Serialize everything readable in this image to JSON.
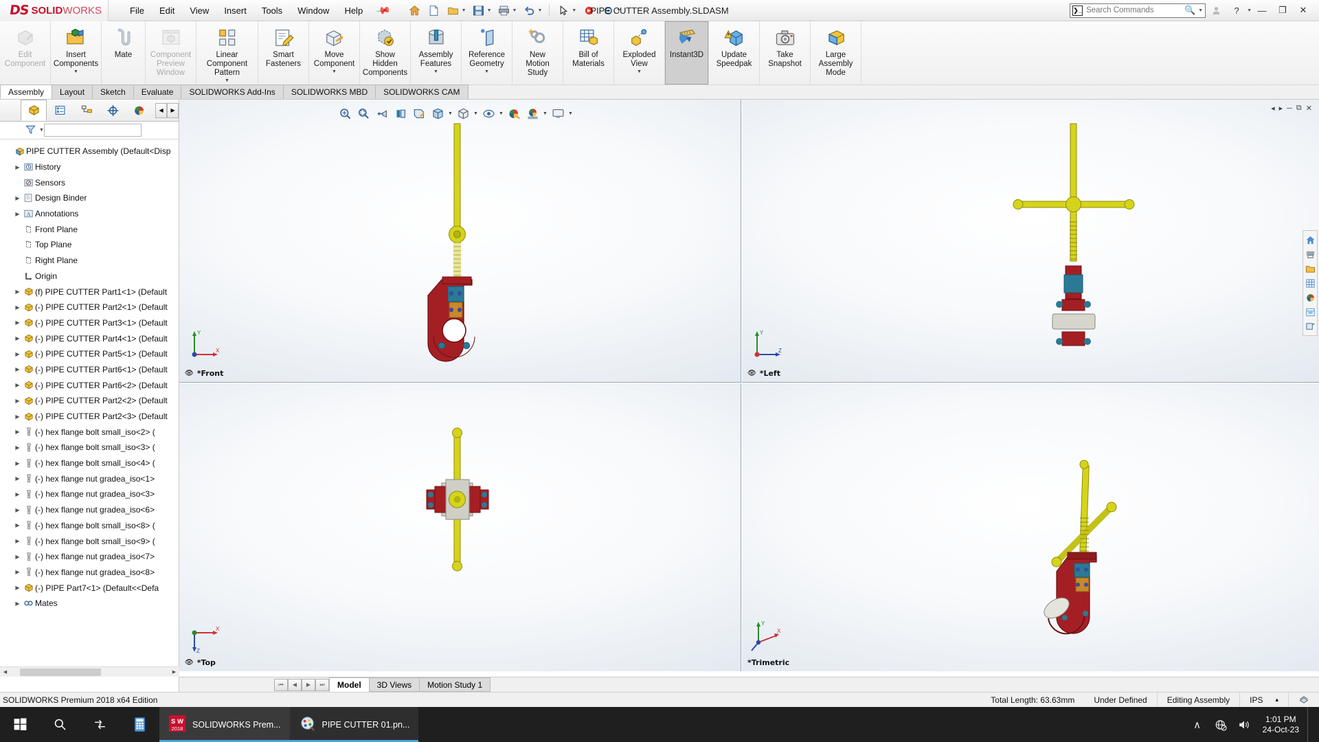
{
  "app": {
    "brand_ds": "DS",
    "brand_solid": "SOLID",
    "brand_works": "WORKS",
    "document_title": "PIPE CUTTER Assembly.SLDASM",
    "edition": "SOLIDWORKS Premium 2018 x64 Edition"
  },
  "menubar": [
    "File",
    "Edit",
    "View",
    "Insert",
    "Tools",
    "Window",
    "Help"
  ],
  "search": {
    "placeholder": "Search Commands",
    "value": ""
  },
  "window_controls": {
    "minimize": "—",
    "restore": "❐",
    "close": "✕",
    "help": "?"
  },
  "ribbon": {
    "buttons": [
      {
        "label": "Edit\nComponent",
        "icon": "edit-component-icon",
        "disabled": true,
        "active": false,
        "caret": false
      },
      {
        "label": "Insert\nComponents",
        "icon": "insert-components-icon",
        "disabled": false,
        "active": false,
        "caret": true
      },
      {
        "label": "Mate",
        "icon": "mate-icon",
        "disabled": false,
        "active": false,
        "caret": false
      },
      {
        "label": "Component\nPreview\nWindow",
        "icon": "component-preview-icon",
        "disabled": true,
        "active": false,
        "caret": false
      },
      {
        "label": "Linear Component\nPattern",
        "icon": "linear-pattern-icon",
        "disabled": false,
        "active": false,
        "caret": true
      },
      {
        "label": "Smart\nFasteners",
        "icon": "smart-fasteners-icon",
        "disabled": false,
        "active": false,
        "caret": false
      },
      {
        "label": "Move\nComponent",
        "icon": "move-component-icon",
        "disabled": false,
        "active": false,
        "caret": true
      },
      {
        "label": "Show\nHidden\nComponents",
        "icon": "show-hidden-icon",
        "disabled": false,
        "active": false,
        "caret": false
      },
      {
        "label": "Assembly\nFeatures",
        "icon": "assembly-features-icon",
        "disabled": false,
        "active": false,
        "caret": true
      },
      {
        "label": "Reference\nGeometry",
        "icon": "reference-geometry-icon",
        "disabled": false,
        "active": false,
        "caret": true
      },
      {
        "label": "New\nMotion\nStudy",
        "icon": "new-motion-study-icon",
        "disabled": false,
        "active": false,
        "caret": false
      },
      {
        "label": "Bill of\nMaterials",
        "icon": "bill-of-materials-icon",
        "disabled": false,
        "active": false,
        "caret": false
      },
      {
        "label": "Exploded\nView",
        "icon": "exploded-view-icon",
        "disabled": false,
        "active": false,
        "caret": true
      },
      {
        "label": "Instant3D",
        "icon": "instant3d-icon",
        "disabled": false,
        "active": true,
        "caret": false
      },
      {
        "label": "Update\nSpeedpak",
        "icon": "update-speedpak-icon",
        "disabled": false,
        "active": false,
        "caret": false
      },
      {
        "label": "Take\nSnapshot",
        "icon": "take-snapshot-icon",
        "disabled": false,
        "active": false,
        "caret": false
      },
      {
        "label": "Large\nAssembly\nMode",
        "icon": "large-assembly-icon",
        "disabled": false,
        "active": false,
        "caret": false
      }
    ]
  },
  "command_tabs": [
    {
      "label": "Assembly",
      "selected": true
    },
    {
      "label": "Layout",
      "selected": false
    },
    {
      "label": "Sketch",
      "selected": false
    },
    {
      "label": "Evaluate",
      "selected": false
    },
    {
      "label": "SOLIDWORKS Add-Ins",
      "selected": false
    },
    {
      "label": "SOLIDWORKS MBD",
      "selected": false
    },
    {
      "label": "SOLIDWORKS CAM",
      "selected": false
    }
  ],
  "feature_manager": {
    "tabs": [
      "feature-tree-tab",
      "property-manager-tab",
      "configuration-manager-tab",
      "dimxpert-tab",
      "display-manager-tab"
    ],
    "filter_placeholder": "",
    "tree": [
      {
        "label": "PIPE CUTTER Assembly  (Default<Disp",
        "icon": "assembly-icon",
        "indent": 0,
        "expand": ""
      },
      {
        "label": "History",
        "icon": "history-icon",
        "indent": 1,
        "expand": "▶"
      },
      {
        "label": "Sensors",
        "icon": "sensors-icon",
        "indent": 1,
        "expand": ""
      },
      {
        "label": "Design Binder",
        "icon": "folder-icon",
        "indent": 1,
        "expand": "▶"
      },
      {
        "label": "Annotations",
        "icon": "annotations-icon",
        "indent": 1,
        "expand": "▶"
      },
      {
        "label": "Front Plane",
        "icon": "plane-icon",
        "indent": 1,
        "expand": ""
      },
      {
        "label": "Top Plane",
        "icon": "plane-icon",
        "indent": 1,
        "expand": ""
      },
      {
        "label": "Right Plane",
        "icon": "plane-icon",
        "indent": 1,
        "expand": ""
      },
      {
        "label": "Origin",
        "icon": "origin-icon",
        "indent": 1,
        "expand": ""
      },
      {
        "label": "(f) PIPE CUTTER Part1<1> (Default",
        "icon": "part-icon",
        "indent": 1,
        "expand": "▶"
      },
      {
        "label": "(-) PIPE CUTTER Part2<1> (Default",
        "icon": "part-icon",
        "indent": 1,
        "expand": "▶"
      },
      {
        "label": "(-) PIPE CUTTER Part3<1> (Default",
        "icon": "part-icon",
        "indent": 1,
        "expand": "▶"
      },
      {
        "label": "(-) PIPE CUTTER Part4<1> (Default",
        "icon": "part-icon",
        "indent": 1,
        "expand": "▶"
      },
      {
        "label": "(-) PIPE CUTTER Part5<1> (Default",
        "icon": "part-icon",
        "indent": 1,
        "expand": "▶"
      },
      {
        "label": "(-) PIPE CUTTER Part6<1> (Default",
        "icon": "part-icon",
        "indent": 1,
        "expand": "▶"
      },
      {
        "label": "(-) PIPE CUTTER Part6<2> (Default",
        "icon": "part-icon",
        "indent": 1,
        "expand": "▶"
      },
      {
        "label": "(-) PIPE CUTTER Part2<2> (Default",
        "icon": "part-icon",
        "indent": 1,
        "expand": "▶"
      },
      {
        "label": "(-) PIPE CUTTER Part2<3> (Default",
        "icon": "part-icon",
        "indent": 1,
        "expand": "▶"
      },
      {
        "label": "(-) hex flange bolt small_iso<2> (",
        "icon": "bolt-icon",
        "indent": 1,
        "expand": "▶"
      },
      {
        "label": "(-) hex flange bolt small_iso<3> (",
        "icon": "bolt-icon",
        "indent": 1,
        "expand": "▶"
      },
      {
        "label": "(-) hex flange bolt small_iso<4> (",
        "icon": "bolt-icon",
        "indent": 1,
        "expand": "▶"
      },
      {
        "label": "(-) hex flange nut gradea_iso<1>",
        "icon": "bolt-icon",
        "indent": 1,
        "expand": "▶"
      },
      {
        "label": "(-) hex flange nut gradea_iso<3>",
        "icon": "bolt-icon",
        "indent": 1,
        "expand": "▶"
      },
      {
        "label": "(-) hex flange nut gradea_iso<6>",
        "icon": "bolt-icon",
        "indent": 1,
        "expand": "▶"
      },
      {
        "label": "(-) hex flange bolt small_iso<8> (",
        "icon": "bolt-icon",
        "indent": 1,
        "expand": "▶"
      },
      {
        "label": "(-) hex flange bolt small_iso<9> (",
        "icon": "bolt-icon",
        "indent": 1,
        "expand": "▶"
      },
      {
        "label": "(-) hex flange nut gradea_iso<7>",
        "icon": "bolt-icon",
        "indent": 1,
        "expand": "▶"
      },
      {
        "label": "(-) hex flange nut gradea_iso<8>",
        "icon": "bolt-icon",
        "indent": 1,
        "expand": "▶"
      },
      {
        "label": "(-) PIPE Part7<1> (Default<<Defa",
        "icon": "part-icon",
        "indent": 1,
        "expand": "▶"
      },
      {
        "label": "Mates",
        "icon": "mates-icon",
        "indent": 1,
        "expand": "▶"
      }
    ]
  },
  "view_toolbar": [
    "zoom-to-fit-icon",
    "zoom-to-area-icon",
    "section-view-icon",
    "view-orientation-icon",
    "display-style-icon",
    "hide-show-items-icon",
    "edit-appearance-icon",
    "apply-scene-icon",
    "view-settings-icon"
  ],
  "right_toolbar": [
    "home-icon",
    "print3d-icon",
    "open-folder-icon",
    "grid-icon",
    "appearance-icon",
    "tile-icon",
    "restore-icon"
  ],
  "viewports": [
    {
      "name": "front-viewport",
      "label": "*Front"
    },
    {
      "name": "left-viewport",
      "label": "*Left"
    },
    {
      "name": "top-viewport",
      "label": "*Top"
    },
    {
      "name": "trimetric-viewport",
      "label": "*Trimetric"
    }
  ],
  "bottom_tabs": [
    {
      "label": "Model",
      "selected": true
    },
    {
      "label": "3D Views",
      "selected": false
    },
    {
      "label": "Motion Study 1",
      "selected": false
    }
  ],
  "statusbar": {
    "left": "SOLIDWORKS Premium 2018 x64 Edition",
    "total_length": "Total Length: 63.63mm",
    "state": "Under Defined",
    "mode": "Editing Assembly",
    "units": "IPS",
    "units_caret": "▴"
  },
  "taskbar": {
    "start": "start-icon",
    "search": "search-icon",
    "taskview": "task-view-icon",
    "calculator": "calculator-icon",
    "apps": [
      {
        "label": "SOLIDWORKS Prem...",
        "icon": "solidworks-app-icon",
        "active": true
      },
      {
        "label": "PIPE CUTTER 01.pn...",
        "icon": "paint-app-icon",
        "active": false
      }
    ],
    "tray": {
      "chevron": "∧",
      "network": "network-disconnected-icon",
      "volume": "volume-icon",
      "time": "1:01 PM",
      "date": "24-Oct-23"
    }
  },
  "colors": {
    "brand_red": "#c8102e",
    "accent_blue": "#4aa3e0",
    "model_yellow": "#d6d419",
    "model_red": "#a41f24",
    "model_teal": "#2a7a96",
    "ribbon_bg": "#f0f0f0"
  }
}
